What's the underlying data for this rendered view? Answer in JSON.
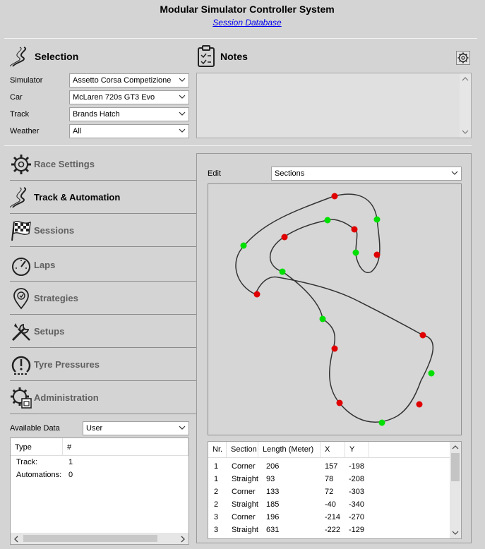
{
  "header": {
    "title": "Modular Simulator Controller System",
    "link": "Session Database"
  },
  "selection": {
    "title": "Selection",
    "fields": [
      {
        "label": "Simulator",
        "value": "Assetto Corsa Competizione"
      },
      {
        "label": "Car",
        "value": "McLaren 720s GT3 Evo"
      },
      {
        "label": "Track",
        "value": "Brands Hatch"
      },
      {
        "label": "Weather",
        "value": "All"
      }
    ]
  },
  "notes": {
    "title": "Notes"
  },
  "nav": [
    {
      "label": "Race Settings",
      "icon": "gear-icon"
    },
    {
      "label": "Track & Automation",
      "icon": "track-icon"
    },
    {
      "label": "Sessions",
      "icon": "checkered-flag-icon"
    },
    {
      "label": "Laps",
      "icon": "speedometer-icon"
    },
    {
      "label": "Strategies",
      "icon": "strategy-pin-icon"
    },
    {
      "label": "Setups",
      "icon": "tools-icon"
    },
    {
      "label": "Tyre Pressures",
      "icon": "tyre-icon"
    },
    {
      "label": "Administration",
      "icon": "admin-gear-icon"
    }
  ],
  "available": {
    "label": "Available Data",
    "value": "User",
    "headers": [
      "Type",
      "#"
    ],
    "rows": [
      [
        "Track:",
        "1"
      ],
      [
        "Automations:",
        "0"
      ]
    ]
  },
  "edit": {
    "label": "Edit",
    "value": "Sections"
  },
  "sections_table": {
    "headers": [
      "Nr.",
      "Section",
      "Length (Meter)",
      "X",
      "Y"
    ],
    "rows": [
      [
        "1",
        "Corner",
        "206",
        "157",
        "-198"
      ],
      [
        "1",
        "Straight",
        "93",
        "78",
        "-208"
      ],
      [
        "2",
        "Corner",
        "133",
        "72",
        "-303"
      ],
      [
        "2",
        "Straight",
        "185",
        "-40",
        "-340"
      ],
      [
        "3",
        "Corner",
        "196",
        "-214",
        "-270"
      ],
      [
        "3",
        "Straight",
        "631",
        "-222",
        "-129"
      ]
    ]
  },
  "colors": {
    "corner": "#e00000",
    "straight": "#00e000"
  }
}
